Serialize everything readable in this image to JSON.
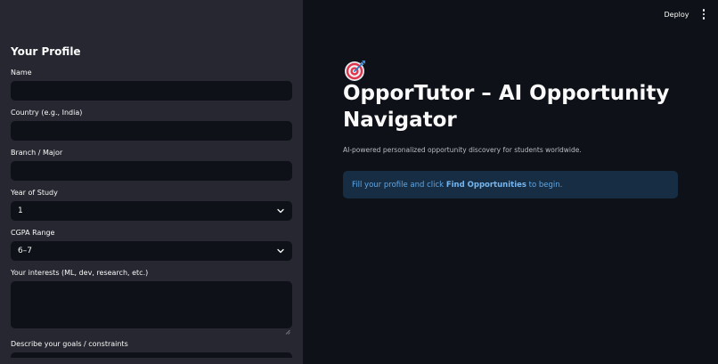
{
  "topbar": {
    "deploy_label": "Deploy"
  },
  "sidebar": {
    "title": "Your Profile",
    "fields": {
      "name": {
        "label": "Name",
        "value": ""
      },
      "country": {
        "label": "Country (e.g., India)",
        "value": ""
      },
      "branch": {
        "label": "Branch / Major",
        "value": ""
      },
      "year": {
        "label": "Year of Study",
        "value": "1"
      },
      "cgpa": {
        "label": "CGPA Range",
        "value": "6–7"
      },
      "interests": {
        "label": "Your interests (ML, dev, research, etc.)",
        "value": ""
      },
      "goals": {
        "label": "Describe your goals / constraints"
      }
    }
  },
  "main": {
    "title_icon": "target-icon",
    "title": "OpporTutor – AI Opportunity Navigator",
    "subtitle": "AI-powered personalized opportunity discovery for students worldwide.",
    "info": {
      "prefix": "Fill your profile and click ",
      "bold": "Find Opportunities",
      "suffix": " to begin."
    }
  },
  "colors": {
    "background": "#0e1117",
    "sidebar": "#262730",
    "info_bg": "#172d43",
    "info_text": "#5fa8e8"
  }
}
